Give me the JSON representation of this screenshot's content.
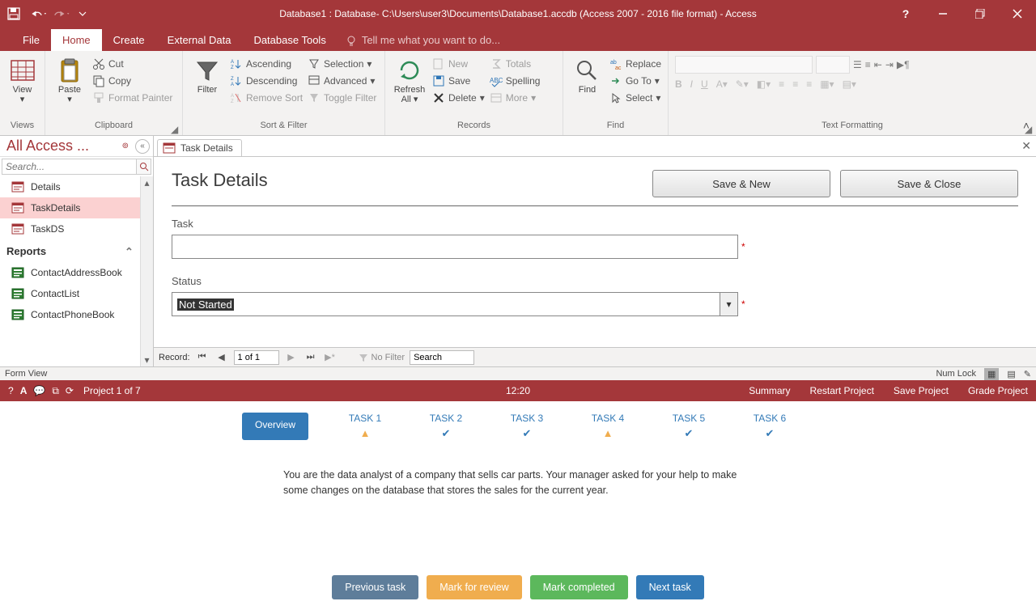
{
  "title": "Database1 : Database- C:\\Users\\user3\\Documents\\Database1.accdb (Access 2007 - 2016 file format) - Access",
  "tabs": {
    "file": "File",
    "home": "Home",
    "create": "Create",
    "external": "External Data",
    "tools": "Database Tools",
    "tellme": "Tell me what you want to do..."
  },
  "ribbon": {
    "views": {
      "label": "Views",
      "view": "View"
    },
    "clipboard": {
      "label": "Clipboard",
      "paste": "Paste",
      "cut": "Cut",
      "copy": "Copy",
      "painter": "Format Painter"
    },
    "sortfilter": {
      "label": "Sort & Filter",
      "filter": "Filter",
      "asc": "Ascending",
      "desc": "Descending",
      "remove": "Remove Sort",
      "selection": "Selection",
      "advanced": "Advanced",
      "toggle": "Toggle Filter"
    },
    "records": {
      "label": "Records",
      "refresh": "Refresh All",
      "new": "New",
      "save": "Save",
      "delete": "Delete",
      "totals": "Totals",
      "spelling": "Spelling",
      "more": "More"
    },
    "find": {
      "label": "Find",
      "find": "Find",
      "replace": "Replace",
      "goto": "Go To",
      "select": "Select"
    },
    "textfmt": {
      "label": "Text Formatting"
    }
  },
  "nav": {
    "title": "All Access ...",
    "placeholder": "Search...",
    "items": [
      "Details",
      "TaskDetails",
      "TaskDS"
    ],
    "reports_header": "Reports",
    "reports": [
      "ContactAddressBook",
      "ContactList",
      "ContactPhoneBook"
    ]
  },
  "doc_tab": "Task Details",
  "form": {
    "title": "Task Details",
    "save_new": "Save & New",
    "save_close": "Save & Close",
    "task_label": "Task",
    "task_value": "",
    "status_label": "Status",
    "status_value": "Not Started"
  },
  "recnav": {
    "label": "Record:",
    "pos": "1 of 1",
    "nofilter": "No Filter",
    "search": "Search"
  },
  "status": {
    "left": "Form View",
    "numlock": "Num Lock"
  },
  "project": {
    "label": "Project 1 of 7",
    "time": "12:20",
    "links": [
      "Summary",
      "Restart Project",
      "Save Project",
      "Grade Project"
    ],
    "overview": "Overview",
    "tasks": [
      {
        "label": "TASK 1",
        "state": "warn"
      },
      {
        "label": "TASK 2",
        "state": "check"
      },
      {
        "label": "TASK 3",
        "state": "check"
      },
      {
        "label": "TASK 4",
        "state": "warn"
      },
      {
        "label": "TASK 5",
        "state": "check"
      },
      {
        "label": "TASK 6",
        "state": "check"
      }
    ],
    "desc": "You are the data analyst of a company that sells car parts. Your manager asked for your help to make some changes on the database that stores the sales for the current year.",
    "buttons": {
      "prev": "Previous task",
      "mark": "Mark for review",
      "done": "Mark completed",
      "next": "Next task"
    }
  }
}
